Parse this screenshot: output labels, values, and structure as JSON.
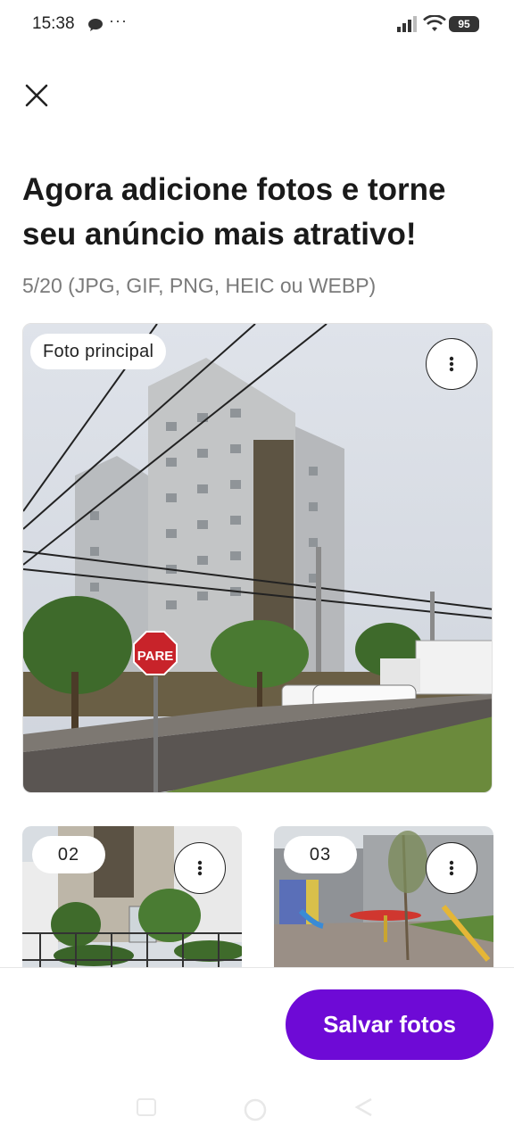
{
  "status_bar": {
    "time": "15:38",
    "dots": "···",
    "battery": "95",
    "icons": [
      "chat-icon",
      "signal-icon",
      "wifi-icon",
      "battery-icon"
    ]
  },
  "header": {
    "close_icon": "close-icon",
    "title": "Agora adicione fotos e torne seu anúncio mais atrativo!",
    "subtitle": "5/20 (JPG, GIF, PNG, HEIC ou WEBP)"
  },
  "photos": {
    "main_badge": "Foto principal",
    "main_sign": "PARE",
    "menu_icon": "more-vertical-icon",
    "thumbnails": [
      {
        "label": "02"
      },
      {
        "label": "03"
      }
    ]
  },
  "footer": {
    "save_label": "Salvar fotos",
    "accent": "#6e0ad6"
  },
  "nav": [
    "recent-apps-icon",
    "home-icon",
    "back-icon"
  ]
}
